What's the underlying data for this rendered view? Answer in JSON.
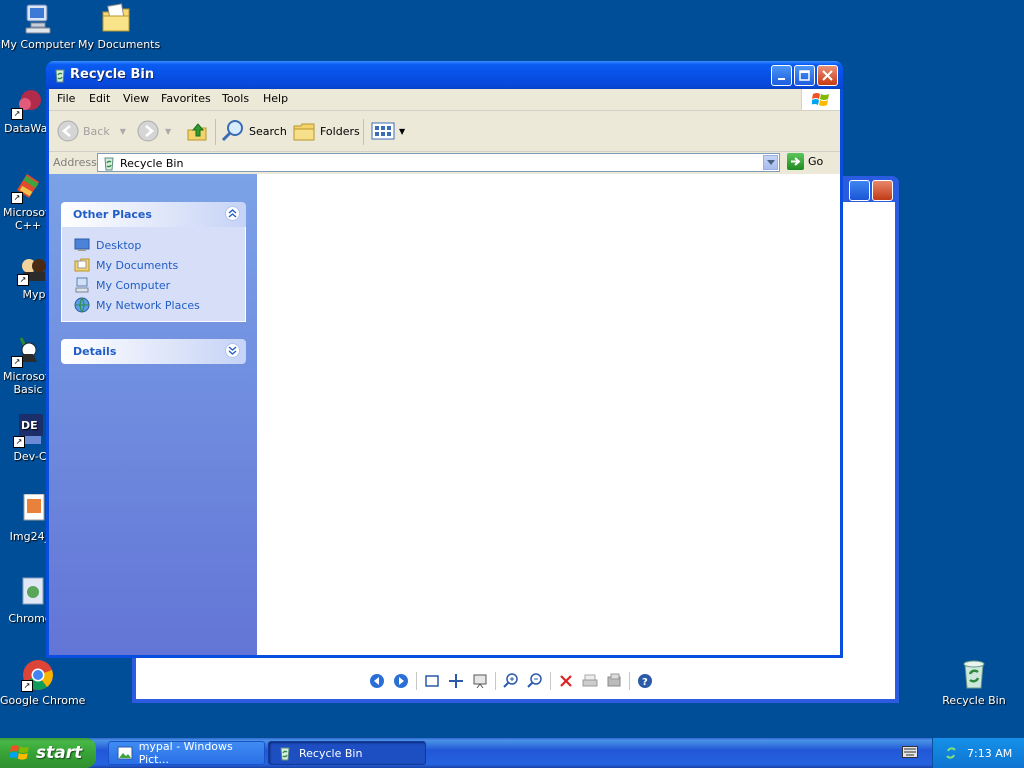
{
  "desktop": {
    "icons": [
      {
        "label": "My Computer",
        "icon": "computer-icon"
      },
      {
        "label": "My Documents",
        "icon": "documents-folder-icon"
      },
      {
        "label": "DataWar",
        "icon": "app-shortcut-icon"
      },
      {
        "label": "Microsoft C++",
        "icon": "visual-cpp-icon"
      },
      {
        "label": "Myp",
        "icon": "app-shortcut-icon"
      },
      {
        "label": "Microsoft Basic",
        "icon": "visual-basic-icon"
      },
      {
        "label": "Dev-C",
        "icon": "dev-cpp-icon"
      },
      {
        "label": "Img24_(",
        "icon": "image-file-icon"
      },
      {
        "label": "Chrome",
        "icon": "chrome-setup-icon"
      },
      {
        "label": "Google Chrome",
        "icon": "chrome-icon"
      },
      {
        "label": "Recycle Bin",
        "icon": "recycle-bin-icon"
      }
    ]
  },
  "window": {
    "title": "Recycle Bin",
    "menu": [
      "File",
      "Edit",
      "View",
      "Favorites",
      "Tools",
      "Help"
    ],
    "toolbar": {
      "back": "Back",
      "search": "Search",
      "folders": "Folders"
    },
    "address": {
      "label": "Address",
      "value": "Recycle Bin",
      "go": "Go"
    },
    "taskpane": {
      "other_places": {
        "title": "Other Places",
        "items": [
          "Desktop",
          "My Documents",
          "My Computer",
          "My Network Places"
        ]
      },
      "details": {
        "title": "Details"
      }
    }
  },
  "taskbar": {
    "start": "start",
    "tasks": [
      {
        "label": "mypal - Windows Pict...",
        "active": false
      },
      {
        "label": "Recycle Bin",
        "active": true
      }
    ],
    "clock": "7:13 AM"
  },
  "colors": {
    "desktop": "#004e98",
    "title_bar": "#0850e6",
    "link_text": "#215dc6",
    "start_button": "#37a337"
  }
}
